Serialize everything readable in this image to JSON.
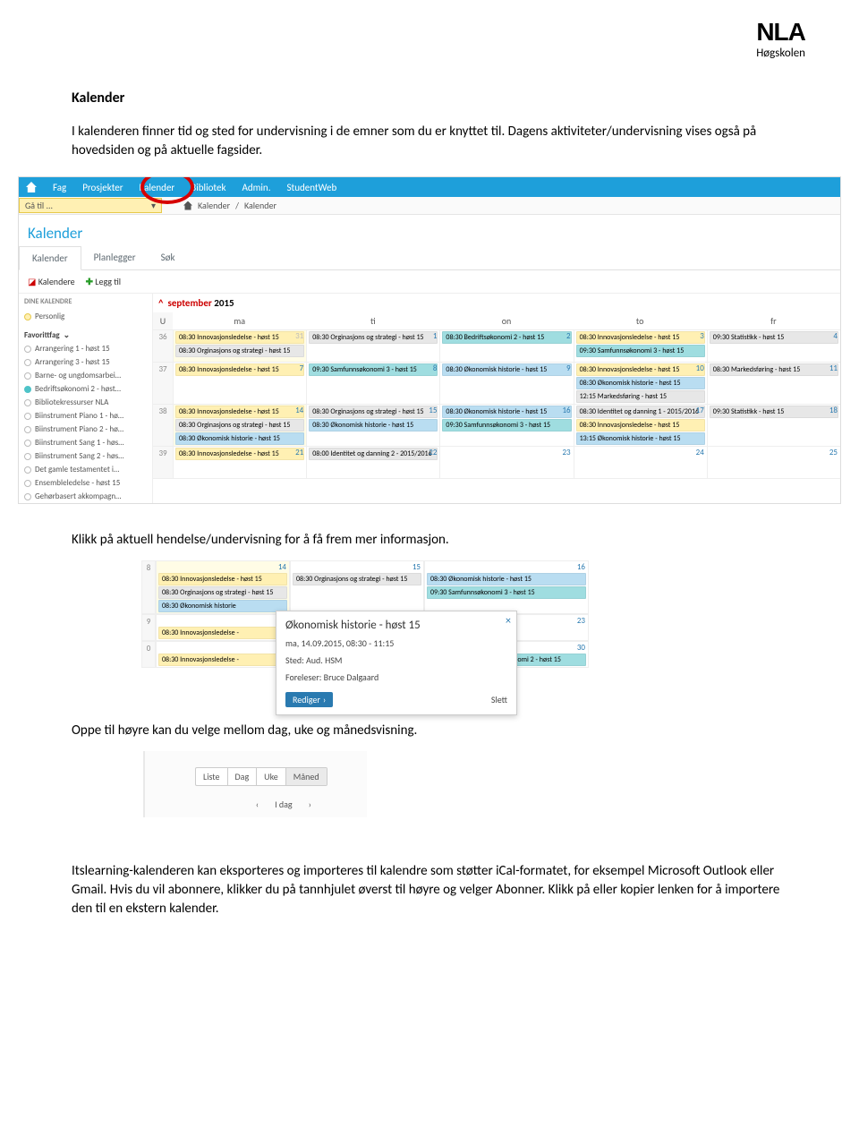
{
  "logo": {
    "main": "NLA",
    "sub": "Høgskolen"
  },
  "doc": {
    "h1": "Kalender",
    "p1": "I kalenderen finner tid og sted for undervisning i de emner som du er knyttet til. Dagens aktiviteter/undervisning vises også på hovedsiden og på aktuelle fagsider.",
    "p2": "Klikk på aktuell hendelse/undervisning for å få frem mer informasjon.",
    "p3": "Oppe til høyre kan du velge mellom dag, uke og månedsvisning.",
    "p4": "Itslearning-kalenderen kan eksporteres og importeres til kalendre som støtter iCal-formatet, for eksempel Microsoft Outlook eller Gmail. Hvis du vil abonnere, klikker du på tannhjulet øverst til høyre og velger Abonner. Klikk på eller kopier lenken for å importere den til en ekstern kalender."
  },
  "nav": {
    "items": [
      "Fag",
      "Prosjekter",
      "Kalender",
      "Bibliotek",
      "Admin.",
      "StudentWeb"
    ],
    "goto": "Gå til ...",
    "crumbs": [
      "Kalender",
      "/",
      "Kalender"
    ]
  },
  "cal": {
    "title": "Kalender",
    "tabs": [
      "Kalender",
      "Planlegger",
      "Søk"
    ],
    "toolbar": {
      "kalendere": "Kalendere",
      "legg_til": "Legg til"
    },
    "side": {
      "hdr": "DINE KALENDRE",
      "personlig": "Personlig",
      "fav": "Favorittfag",
      "items": [
        "Arrangering 1 - høst 15",
        "Arrangering 3 - høst 15",
        "Barne- og ungdomsarbei…",
        "Bedriftsøkonomi 2 - høst…",
        "Bibliotekressurser NLA",
        "Biinstrument Piano 1 - hø…",
        "Biinstrument Piano 2 - hø…",
        "Biinstrument Sang 1 - høs…",
        "Biinstrument Sang 2 - høs…",
        "Det gamle testamentet i…",
        "Ensembleledelse - høst 15",
        "Gehørbasert akkompagn…"
      ]
    },
    "month": {
      "chev": "^",
      "name": "september",
      "year": "2015"
    },
    "head": [
      "U",
      "ma",
      "ti",
      "on",
      "to",
      "fr"
    ],
    "weeks": [
      {
        "no": "36",
        "days": [
          {
            "n": "31",
            "out": true,
            "today": true,
            "ev": [
              {
                "t": "08:30 Innovasjonsledelse - høst 15",
                "c": "yl"
              },
              {
                "t": "08:30 Orginasjons og strategi - høst 15",
                "c": "gr"
              }
            ]
          },
          {
            "n": "1",
            "ev": [
              {
                "t": "08:30 Orginasjons og strategi - høst 15",
                "c": "gr"
              }
            ]
          },
          {
            "n": "2",
            "ev": [
              {
                "t": "08:30 Bedriftsøkonomi 2 - høst 15",
                "c": "te"
              }
            ]
          },
          {
            "n": "3",
            "ev": [
              {
                "t": "08:30 Innovasjonsledelse - høst 15",
                "c": "yl"
              },
              {
                "t": "09:30 Samfunnsøkonomi 3 - høst 15",
                "c": "te"
              }
            ]
          },
          {
            "n": "4",
            "ev": [
              {
                "t": "09:30 Statistikk - høst 15",
                "c": "gr"
              }
            ]
          }
        ]
      },
      {
        "no": "37",
        "days": [
          {
            "n": "7",
            "ev": [
              {
                "t": "08:30 Innovasjonsledelse - høst 15",
                "c": "yl"
              }
            ]
          },
          {
            "n": "8",
            "ev": [
              {
                "t": "09:30 Samfunnsøkonomi 3 - høst 15",
                "c": "te"
              }
            ]
          },
          {
            "n": "9",
            "ev": [
              {
                "t": "08:30 Økonomisk historie - høst 15",
                "c": "bl"
              }
            ]
          },
          {
            "n": "10",
            "ev": [
              {
                "t": "08:30 Innovasjonsledelse - høst 15",
                "c": "yl"
              },
              {
                "t": "08:30 Økonomisk historie - høst 15",
                "c": "bl"
              },
              {
                "t": "12:15 Markedsføring - høst 15",
                "c": "gr"
              }
            ]
          },
          {
            "n": "11",
            "ev": [
              {
                "t": "08:30 Markedsføring - høst 15",
                "c": "gr"
              }
            ]
          }
        ]
      },
      {
        "no": "38",
        "days": [
          {
            "n": "14",
            "today": true,
            "ev": [
              {
                "t": "08:30 Innovasjonsledelse - høst 15",
                "c": "yl"
              },
              {
                "t": "08:30 Orginasjons og strategi - høst 15",
                "c": "gr"
              },
              {
                "t": "08:30 Økonomisk historie - høst 15",
                "c": "bl"
              }
            ]
          },
          {
            "n": "15",
            "ev": [
              {
                "t": "08:30 Orginasjons og strategi - høst 15",
                "c": "gr"
              },
              {
                "t": "08:30 Økonomisk historie - høst 15",
                "c": "bl"
              }
            ]
          },
          {
            "n": "16",
            "ev": [
              {
                "t": "08:30 Økonomisk historie - høst 15",
                "c": "bl"
              },
              {
                "t": "09:30 Samfunnsøkonomi 3 - høst 15",
                "c": "te"
              }
            ]
          },
          {
            "n": "17",
            "ev": [
              {
                "t": "08:30 Identitet og danning 1 - 2015/2016",
                "c": "gr"
              },
              {
                "t": "08:30 Innovasjonsledelse - høst 15",
                "c": "yl"
              },
              {
                "t": "13:15 Økonomisk historie - høst 15",
                "c": "bl"
              }
            ]
          },
          {
            "n": "18",
            "ev": [
              {
                "t": "09:30 Statistikk - høst 15",
                "c": "gr"
              }
            ]
          }
        ]
      },
      {
        "no": "39",
        "days": [
          {
            "n": "21",
            "ev": [
              {
                "t": "08:30 Innovasjonsledelse - høst 15",
                "c": "yl"
              }
            ]
          },
          {
            "n": "22",
            "ev": [
              {
                "t": "08:00 Identitet og danning 2 - 2015/2016",
                "c": "gr"
              }
            ]
          },
          {
            "n": "23",
            "ev": []
          },
          {
            "n": "24",
            "ev": []
          },
          {
            "n": "25",
            "ev": []
          }
        ]
      }
    ]
  },
  "shot2": {
    "wk1": "8",
    "d14": "14",
    "d15": "15",
    "d16": "16",
    "r1": [
      [
        {
          "t": "08:30 Innovasjonsledelse - høst 15",
          "c": "yl"
        },
        {
          "t": "08:30 Orginasjons og strategi - høst 15",
          "c": "gr"
        },
        null
      ],
      [
        {
          "t": "08:30 Orginasjons og strategi - høst 15",
          "c": "gr"
        }
      ],
      [
        {
          "t": "08:30 Økonomisk historie - høst 15",
          "c": "bl"
        },
        {
          "t": "09:30 Samfunnsøkonomi 3 - høst 15",
          "c": "te"
        }
      ]
    ],
    "r1b": {
      "t": "08:30 Økonomisk historie",
      "c": "bl"
    },
    "wk2": "9",
    "d23": "23",
    "r2a": {
      "t": "08:30 Innovasjonsledelse -",
      "c": "yl"
    },
    "wk3": "0",
    "d30": "30",
    "r3a": {
      "t": "08:30 Innovasjonsledelse -",
      "c": "yl"
    },
    "r3b": {
      "t": "onomi 2 - høst 15",
      "c": "te"
    },
    "popup": {
      "title": "Økonomisk historie - høst 15",
      "date": "ma, 14.09.2015, 08:30 - 11:15",
      "place": "Sted: Aud. HSM",
      "lect": "Foreleser: Bruce Dalgaard",
      "edit": "Rediger",
      "del": "Slett"
    }
  },
  "shot3": {
    "views": [
      "Liste",
      "Dag",
      "Uke",
      "Måned"
    ],
    "prev": "‹",
    "today": "I dag",
    "next": "›"
  }
}
